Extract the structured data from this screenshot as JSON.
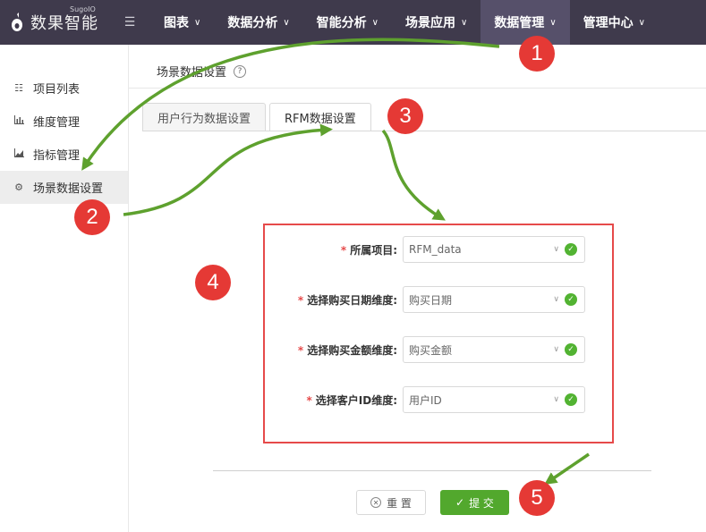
{
  "app": {
    "logo_text": "数果智能",
    "logo_sub": "SugoIO"
  },
  "nav": {
    "items": [
      {
        "label": "图表",
        "active": false
      },
      {
        "label": "数据分析",
        "active": false
      },
      {
        "label": "智能分析",
        "active": false
      },
      {
        "label": "场景应用",
        "active": false
      },
      {
        "label": "数据管理",
        "active": true
      },
      {
        "label": "管理中心",
        "active": false
      }
    ]
  },
  "sidebar": {
    "items": [
      {
        "label": "项目列表",
        "icon": "list-icon"
      },
      {
        "label": "维度管理",
        "icon": "bar-chart-icon"
      },
      {
        "label": "指标管理",
        "icon": "area-chart-icon"
      },
      {
        "label": "场景数据设置",
        "icon": "gear-icon",
        "active": true
      }
    ]
  },
  "page": {
    "title": "场景数据设置",
    "tabs": [
      {
        "label": "用户行为数据设置",
        "active": false
      },
      {
        "label": "RFM数据设置",
        "active": true
      }
    ]
  },
  "form": {
    "fields": [
      {
        "label": "所属项目:",
        "value": "RFM_data"
      },
      {
        "label": "选择购买日期维度:",
        "value": "购买日期"
      },
      {
        "label": "选择购买金额维度:",
        "value": "购买金额"
      },
      {
        "label": "选择客户ID维度:",
        "value": "用户ID"
      }
    ],
    "reset_label": "重 置",
    "submit_label": "提 交"
  },
  "callouts": [
    "1",
    "2",
    "3",
    "4",
    "5"
  ],
  "colors": {
    "topbar": "#3f3a4c",
    "accent_green": "#52a82d",
    "callout_red": "#e53935",
    "arrow_green": "#5ea12e"
  }
}
